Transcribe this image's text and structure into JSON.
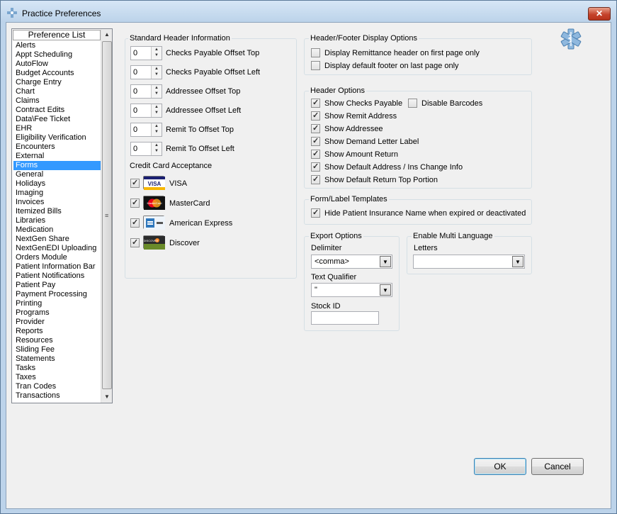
{
  "window": {
    "title": "Practice Preferences"
  },
  "preference_list": {
    "header": "Preference List",
    "items": [
      "Alerts",
      "Appt Scheduling",
      "AutoFlow",
      "Budget Accounts",
      "Charge Entry",
      "Chart",
      "Claims",
      "Contract Edits",
      "Data\\Fee Ticket",
      "EHR",
      "Eligibility Verification",
      "Encounters",
      "External",
      "Forms",
      "General",
      "Holidays",
      "Imaging",
      "Invoices",
      "Itemized Bills",
      "Libraries",
      "Medication",
      "NextGen Share",
      "NextGenEDI Uploading",
      "Orders Module",
      "Patient Information Bar",
      "Patient Notifications",
      "Patient Pay",
      "Payment Processing",
      "Printing",
      "Programs",
      "Provider",
      "Reports",
      "Resources",
      "Sliding Fee",
      "Statements",
      "Tasks",
      "Taxes",
      "Tran Codes",
      "Transactions"
    ],
    "selected": "Forms"
  },
  "standard_header": {
    "title": "Standard Header Information",
    "fields": [
      {
        "label": "Checks Payable Offset Top",
        "value": "0"
      },
      {
        "label": "Checks Payable Offset Left",
        "value": "0"
      },
      {
        "label": "Addressee Offset Top",
        "value": "0"
      },
      {
        "label": "Addressee Offset Left",
        "value": "0"
      },
      {
        "label": "Remit To Offset Top",
        "value": "0"
      },
      {
        "label": "Remit To Offset Left",
        "value": "0"
      }
    ],
    "credit_card_title": "Credit Card Acceptance",
    "cards": [
      {
        "label": "VISA",
        "checked": true,
        "icon": "visa-logo-icon",
        "logo_text": "VISA"
      },
      {
        "label": "MasterCard",
        "checked": true,
        "icon": "mastercard-logo-icon",
        "logo_text": "MasterCard"
      },
      {
        "label": "American Express",
        "checked": true,
        "icon": "amex-logo-icon",
        "logo_text": ""
      },
      {
        "label": "Discover",
        "checked": true,
        "icon": "discover-logo-icon",
        "logo_text": "DISCOVER"
      }
    ]
  },
  "header_footer": {
    "title": "Header/Footer Display Options",
    "options": [
      {
        "label": "Display Remittance header on first page only",
        "checked": false
      },
      {
        "label": "Display default footer on last page only",
        "checked": false
      }
    ]
  },
  "header_options": {
    "title": "Header Options",
    "options": [
      {
        "label": "Show Checks Payable",
        "checked": true
      },
      {
        "label": "Show Remit Address",
        "checked": true
      },
      {
        "label": "Show Addressee",
        "checked": true
      },
      {
        "label": "Show Demand Letter Label",
        "checked": true
      },
      {
        "label": "Show Amount Return",
        "checked": true
      },
      {
        "label": "Show Default Address / Ins Change Info",
        "checked": true
      },
      {
        "label": "Show Default Return Top Portion",
        "checked": true
      }
    ],
    "disable_barcodes": {
      "label": "Disable Barcodes",
      "checked": false
    }
  },
  "form_label": {
    "title": "Form/Label Templates",
    "option": {
      "label": "Hide Patient Insurance Name when expired or deactivated",
      "checked": true
    }
  },
  "export_options": {
    "title": "Export Options",
    "delimiter_label": "Delimiter",
    "delimiter_value": "<comma>",
    "qualifier_label": "Text Qualifier",
    "qualifier_value": "\"",
    "stock_id_label": "Stock ID",
    "stock_id_value": ""
  },
  "multi_language": {
    "title": "Enable Multi Language",
    "letters_label": "Letters",
    "letters_value": ""
  },
  "buttons": {
    "ok": "OK",
    "cancel": "Cancel"
  },
  "colors": {
    "selection": "#3399ff",
    "titlebar": "#bcd3ea",
    "close": "#c5432b"
  }
}
